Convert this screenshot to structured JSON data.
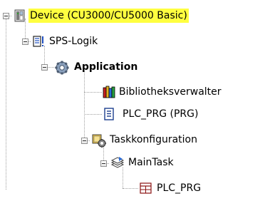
{
  "tree": {
    "items": [
      {
        "label": "Device (CU3000/CU5000 Basic)",
        "icon": "device-icon",
        "selected": true
      },
      {
        "label": "SPS-Logik",
        "icon": "plc-logic-icon"
      },
      {
        "label": "Application",
        "icon": "application-gear-icon"
      },
      {
        "label": "Bibliotheksverwalter",
        "icon": "library-manager-icon"
      },
      {
        "label": "PLC_PRG (PRG)",
        "icon": "program-document-icon"
      },
      {
        "label": "Taskkonfiguration",
        "icon": "task-configuration-icon"
      },
      {
        "label": "MainTask",
        "icon": "task-icon"
      },
      {
        "label": "PLC_PRG",
        "icon": "program-call-icon"
      }
    ]
  },
  "colors": {
    "selection_highlight": "#ffff40",
    "tree_lines": "#a0a0a0"
  }
}
